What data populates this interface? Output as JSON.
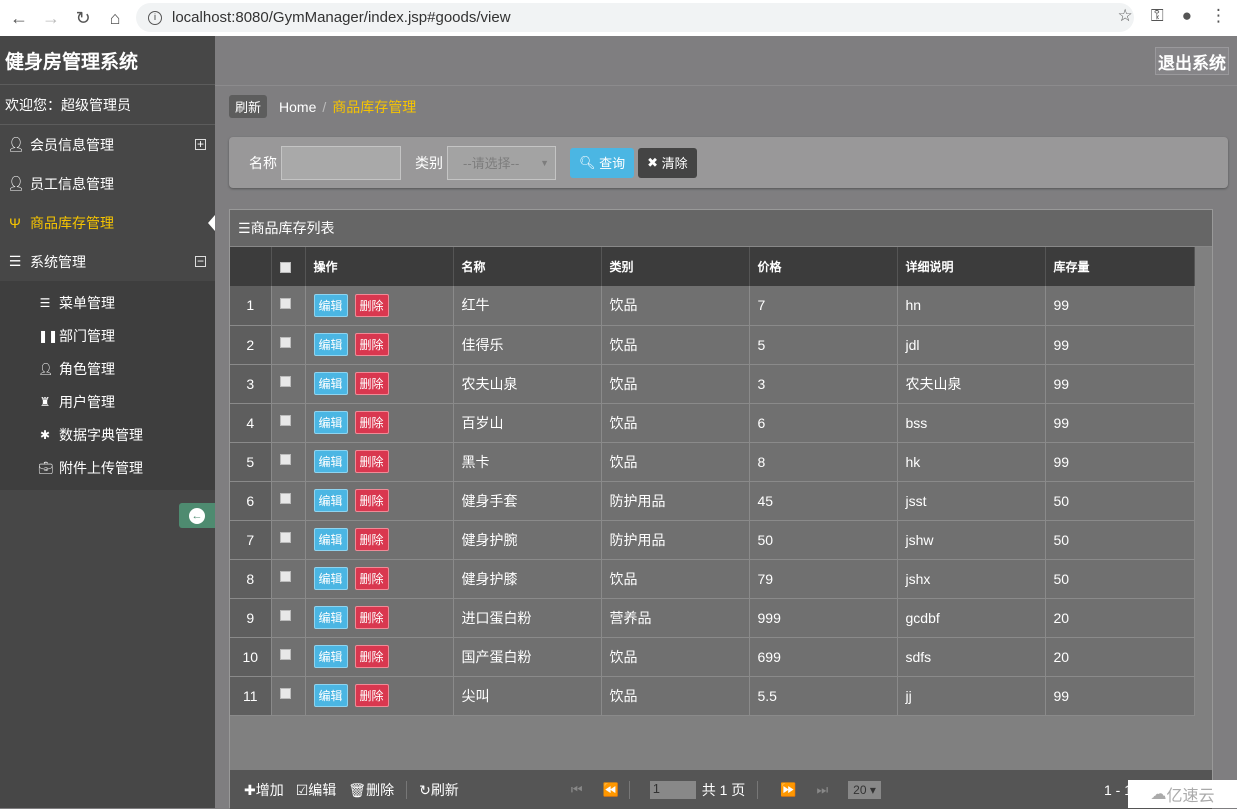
{
  "browser": {
    "url": "localhost:8080/GymManager/index.jsp#goods/view"
  },
  "app": {
    "title": "健身房管理系统",
    "welcome": "欢迎您：超级管理员",
    "logout": "退出系统"
  },
  "sidebar": {
    "items": [
      {
        "label": "会员信息管理",
        "icon": "user-icon",
        "toggle": "⊞"
      },
      {
        "label": "员工信息管理",
        "icon": "user-icon"
      },
      {
        "label": "商品库存管理",
        "icon": "cutlery-icon",
        "active": true
      },
      {
        "label": "系统管理",
        "icon": "list-icon",
        "toggle": "⊟"
      }
    ],
    "subitems": [
      {
        "label": "菜单管理",
        "icon": "list-icon"
      },
      {
        "label": "部门管理",
        "icon": "pause-icon"
      },
      {
        "label": "角色管理",
        "icon": "user-icon"
      },
      {
        "label": "用户管理",
        "icon": "tower-icon"
      },
      {
        "label": "数据字典管理",
        "icon": "asterisk-icon"
      },
      {
        "label": "附件上传管理",
        "icon": "briefcase-icon"
      }
    ]
  },
  "breadcrumb": {
    "refresh": "刷新",
    "home": "Home",
    "sep": "/",
    "current": "商品库存管理"
  },
  "search": {
    "name_label": "名称",
    "name_value": "",
    "category_label": "类别",
    "category_placeholder": "--请选择--",
    "query": "查询",
    "clear": "清除"
  },
  "table": {
    "title": "商品库存列表",
    "columns": [
      "操作",
      "名称",
      "类别",
      "价格",
      "详细说明",
      "库存量"
    ],
    "edit": "编辑",
    "delete": "删除",
    "rows": [
      [
        "1",
        "红牛",
        "饮品",
        "7",
        "hn",
        "99"
      ],
      [
        "2",
        "佳得乐",
        "饮品",
        "5",
        "jdl",
        "99"
      ],
      [
        "3",
        "农夫山泉",
        "饮品",
        "3",
        "农夫山泉",
        "99"
      ],
      [
        "4",
        "百岁山",
        "饮品",
        "6",
        "bss",
        "99"
      ],
      [
        "5",
        "黑卡",
        "饮品",
        "8",
        "hk",
        "99"
      ],
      [
        "6",
        "健身手套",
        "防护用品",
        "45",
        "jsst",
        "50"
      ],
      [
        "7",
        "健身护腕",
        "防护用品",
        "50",
        "jshw",
        "50"
      ],
      [
        "8",
        "健身护膝",
        "饮品",
        "79",
        "jshx",
        "50"
      ],
      [
        "9",
        "进口蛋白粉",
        "营养品",
        "999",
        "gcdbf",
        "20"
      ],
      [
        "10",
        "国产蛋白粉",
        "饮品",
        "699",
        "sdfs",
        "20"
      ],
      [
        "11",
        "尖叫",
        "饮品",
        "5.5",
        "jj",
        "99"
      ]
    ]
  },
  "footer": {
    "add": "增加",
    "edit": "编辑",
    "delete": "删除",
    "refresh": "刷新",
    "page": "1",
    "total_pages": "共 1 页",
    "page_size": "20",
    "range": "1 - 1"
  },
  "watermark": "亿速云",
  "colors": {
    "accent": "#f6c400",
    "edit": "#4bb6e3",
    "delete": "#d9374f"
  }
}
